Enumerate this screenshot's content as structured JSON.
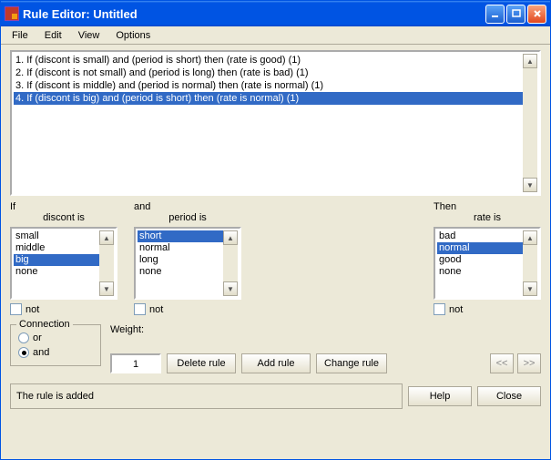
{
  "window": {
    "title": "Rule Editor: Untitled"
  },
  "menu": {
    "file": "File",
    "edit": "Edit",
    "view": "View",
    "options": "Options"
  },
  "rules": [
    "1. If (discont is small) and (period is short) then (rate is good) (1)",
    "2. If (discont is not small) and (period is long) then (rate is bad) (1)",
    "3. If (discont is middle) and (period is normal) then (rate is normal) (1)",
    "4. If (discont is big) and (period is short) then (rate is normal) (1)"
  ],
  "rules_selected_index": 3,
  "cond": {
    "if_kw": "If",
    "and_kw": "and",
    "then_kw": "Then",
    "discont": {
      "label": "discont is",
      "items": [
        "small",
        "middle",
        "big",
        "none"
      ],
      "selected_index": 2
    },
    "period": {
      "label": "period is",
      "items": [
        "short",
        "normal",
        "long",
        "none"
      ],
      "selected_index": 0
    },
    "rate": {
      "label": "rate is",
      "items": [
        "bad",
        "normal",
        "good",
        "none"
      ],
      "selected_index": 1
    },
    "not_label": "not"
  },
  "connection": {
    "legend": "Connection",
    "or_label": "or",
    "and_label": "and",
    "selected": "and"
  },
  "weight": {
    "label": "Weight:",
    "value": "1"
  },
  "buttons": {
    "delete": "Delete rule",
    "add": "Add rule",
    "change": "Change rule",
    "prev": "<<",
    "next": ">>",
    "help": "Help",
    "close": "Close"
  },
  "status": "The rule is added"
}
